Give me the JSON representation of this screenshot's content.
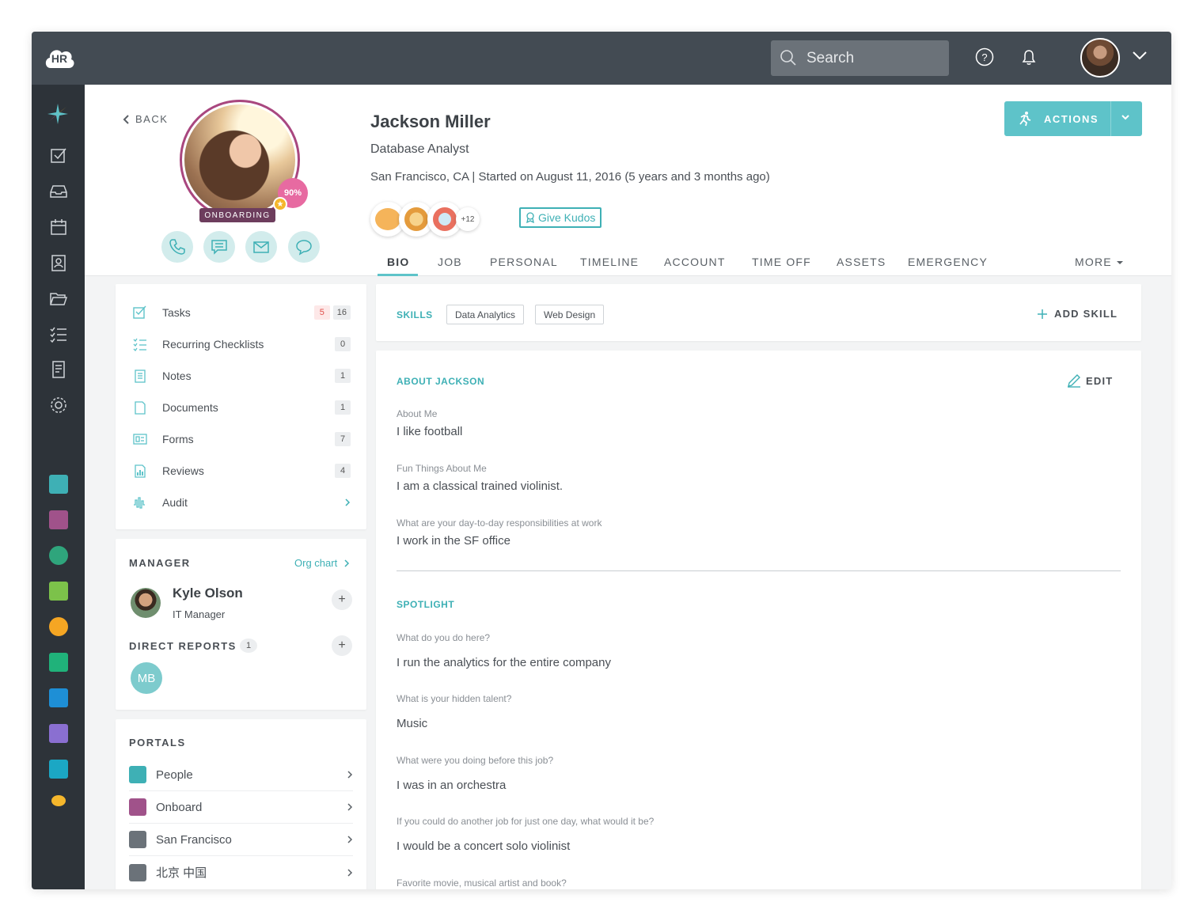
{
  "app": {
    "logo_text": "HR"
  },
  "topbar": {
    "search_placeholder": "Search"
  },
  "header": {
    "back_label": "BACK",
    "completion": "90%",
    "status": "ONBOARDING",
    "name": "Jackson Miller",
    "job_title": "Database Analyst",
    "location_line": "San Francisco, CA | Started on August 11, 2016 (5 years and 3 months ago)",
    "badges_more": "+12",
    "give_kudos": "Give Kudos",
    "actions_label": "ACTIONS"
  },
  "tabs": [
    "BIO",
    "JOB",
    "PERSONAL",
    "TIMELINE",
    "ACCOUNT",
    "TIME OFF",
    "ASSETS",
    "EMERGENCY"
  ],
  "more_label": "MORE",
  "sidebar_list": [
    {
      "label": "Tasks",
      "icon": "checkbox-icon",
      "count_red": "5",
      "count": "16"
    },
    {
      "label": "Recurring Checklists",
      "icon": "checklist-icon",
      "count": "0"
    },
    {
      "label": "Notes",
      "icon": "notes-icon",
      "count": "1"
    },
    {
      "label": "Documents",
      "icon": "documents-icon",
      "count": "1"
    },
    {
      "label": "Forms",
      "icon": "forms-icon",
      "count": "7"
    },
    {
      "label": "Reviews",
      "icon": "reviews-icon",
      "count": "4"
    },
    {
      "label": "Audit",
      "icon": "audit-icon"
    }
  ],
  "manager": {
    "heading": "MANAGER",
    "org_chart": "Org chart",
    "name": "Kyle Olson",
    "title": "IT Manager",
    "direct_reports_heading": "DIRECT REPORTS",
    "direct_reports_count": "1",
    "report_initials": "MB"
  },
  "portals": {
    "heading": "PORTALS",
    "items": [
      {
        "label": "People",
        "color": "#3eb0b5"
      },
      {
        "label": "Onboard",
        "color": "#a0528a"
      },
      {
        "label": "San Francisco",
        "color": "#6b7279"
      },
      {
        "label": "北京 中国",
        "color": "#6b7279"
      }
    ]
  },
  "skills": {
    "heading": "SKILLS",
    "items": [
      "Data Analytics",
      "Web Design"
    ],
    "add_label": "ADD SKILL"
  },
  "about": {
    "heading": "ABOUT JACKSON",
    "edit_label": "EDIT",
    "qa": [
      {
        "q": "About Me",
        "a": "I like football"
      },
      {
        "q": "Fun Things About Me",
        "a": "I am a classical trained violinist."
      },
      {
        "q": "What are your day-to-day responsibilities at work",
        "a": "I work in the SF office"
      }
    ]
  },
  "spotlight": {
    "heading": "SPOTLIGHT",
    "qa": [
      {
        "q": "What do you do here?",
        "a": "I run the analytics for the entire company"
      },
      {
        "q": "What is your hidden talent?",
        "a": "Music"
      },
      {
        "q": "What were you doing before this job?",
        "a": "I was in an orchestra"
      },
      {
        "q": "If you could do another job for just one day, what would it be?",
        "a": "I would be a concert solo violinist"
      },
      {
        "q": "Favorite movie, musical artist and book?",
        "a": ""
      }
    ]
  },
  "colors": {
    "accent": "#3eb0b5",
    "topbar": "#434b53",
    "sidenav": "#2d3339",
    "onboarding": "#6d3d5d",
    "progress": "#e76aa1"
  }
}
